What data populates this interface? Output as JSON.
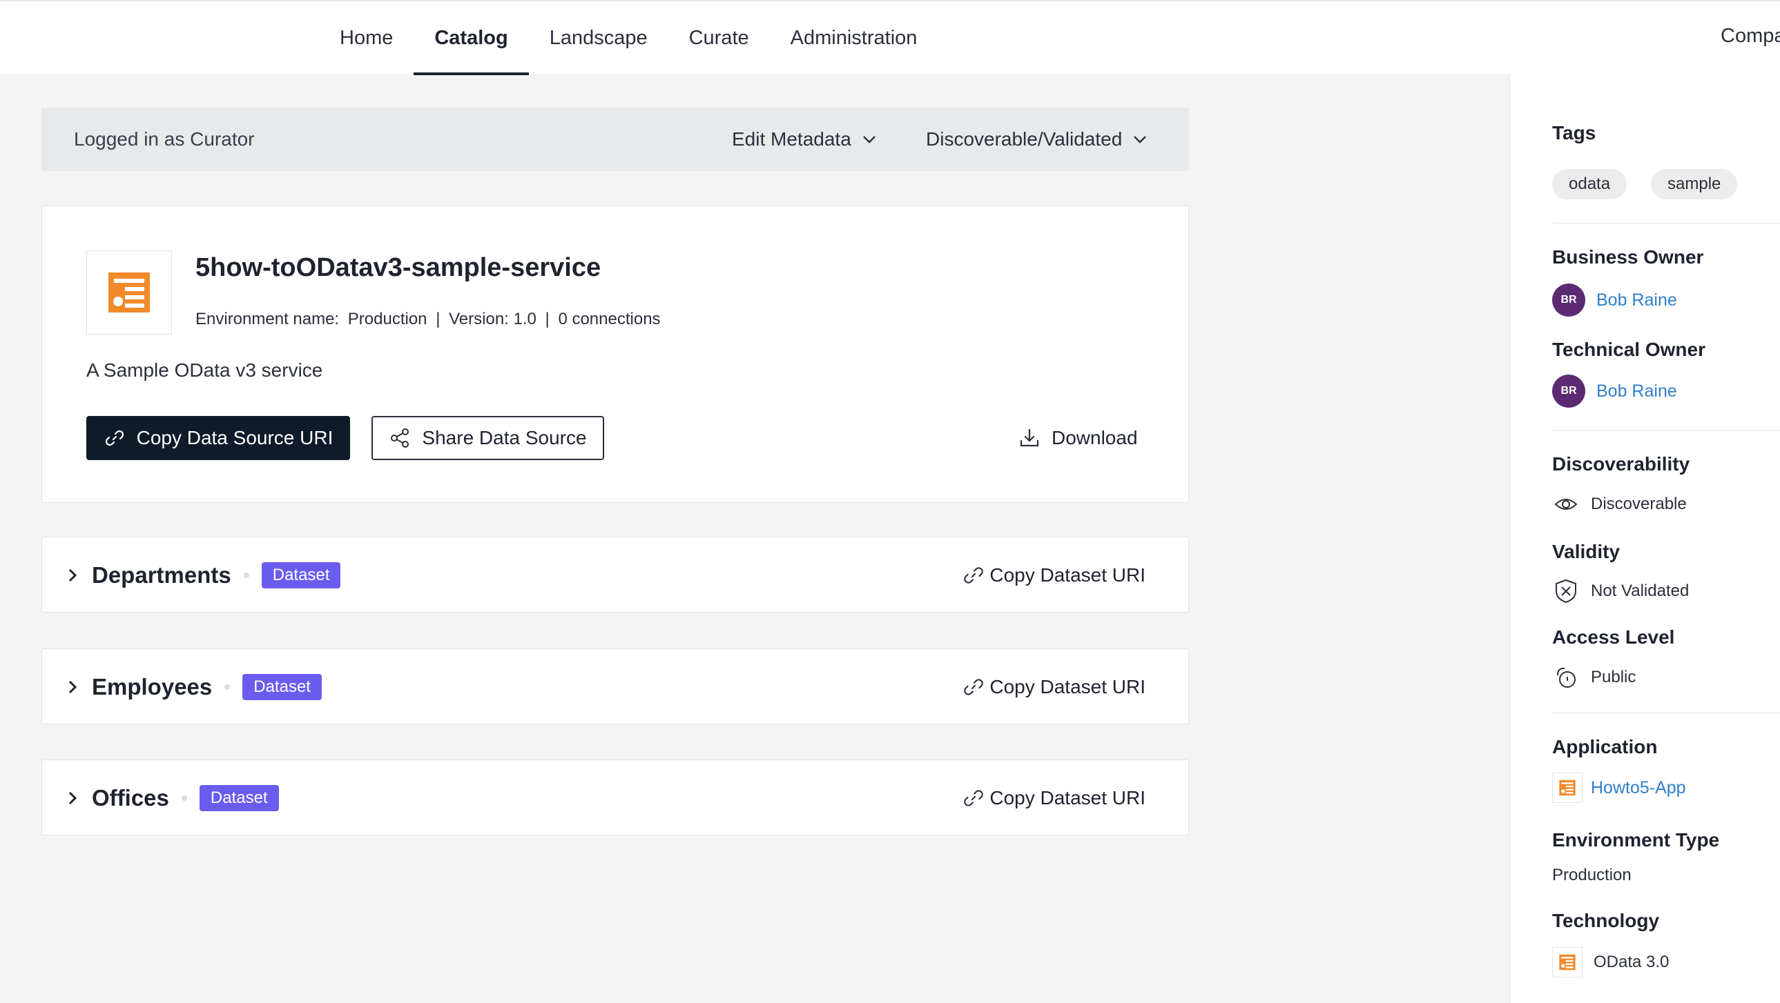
{
  "nav": {
    "items": [
      "Home",
      "Catalog",
      "Landscape",
      "Curate",
      "Administration"
    ],
    "active": "Catalog",
    "company": "Company"
  },
  "curator_bar": {
    "logged_in": "Logged in as Curator",
    "edit_metadata": "Edit Metadata",
    "status": "Discoverable/Validated"
  },
  "source": {
    "title": "5how-toODatav3-sample-service",
    "env_label": "Environment name:",
    "env_value": "Production",
    "version": "Version: 1.0",
    "connections": "0 connections",
    "separator": "|",
    "description": "A Sample OData v3 service",
    "copy_uri": "Copy Data Source URI",
    "share": "Share Data Source",
    "download": "Download",
    "icon": "datasource-list-icon",
    "accent_color": "#f08a2b"
  },
  "datasets": [
    {
      "name": "Departments",
      "badge": "Dataset",
      "action": "Copy Dataset URI"
    },
    {
      "name": "Employees",
      "badge": "Dataset",
      "action": "Copy Dataset URI"
    },
    {
      "name": "Offices",
      "badge": "Dataset",
      "action": "Copy Dataset URI"
    }
  ],
  "sidebar": {
    "tags_title": "Tags",
    "tags": [
      "odata",
      "sample"
    ],
    "business_owner_title": "Business Owner",
    "business_owner": {
      "initials": "BR",
      "name": "Bob Raine"
    },
    "technical_owner_title": "Technical Owner",
    "technical_owner": {
      "initials": "BR",
      "name": "Bob Raine"
    },
    "discoverability_title": "Discoverability",
    "discoverability": "Discoverable",
    "validity_title": "Validity",
    "validity": "Not Validated",
    "access_title": "Access Level",
    "access": "Public",
    "application_title": "Application",
    "application": "Howto5-App",
    "env_type_title": "Environment Type",
    "env_type": "Production",
    "technology_title": "Technology",
    "technology": "OData 3.0"
  },
  "colors": {
    "badge": "#6b5cf0",
    "primary_button": "#0f1a2b",
    "link": "#2f7fc9",
    "avatar": "#5b2a73"
  }
}
